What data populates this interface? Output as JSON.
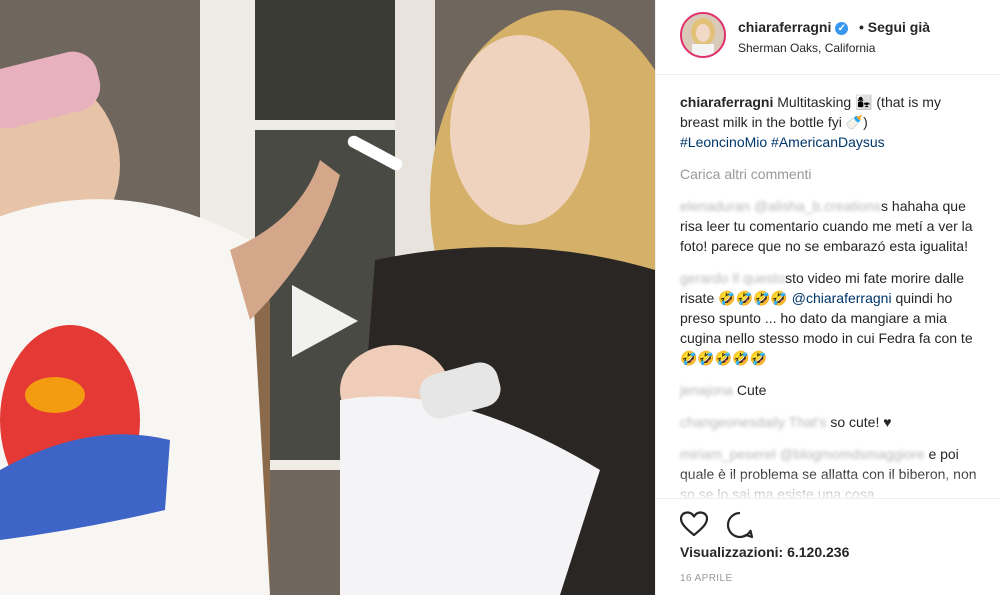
{
  "post": {
    "username": "chiaraferragni",
    "verified_icon": "verified-badge-icon",
    "follow_label": "• Segui già",
    "location": "Sherman Oaks, California"
  },
  "caption": {
    "user": "chiaraferragni",
    "text": "Multitasking 👩‍👧 (that is my breast milk in the bottle fyi 🍼)",
    "hashtags": "#LeoncinoMio #AmericanDaysus"
  },
  "load_more": "Carica altri commenti",
  "comments": [
    {
      "user": "elenaduran",
      "mention": "@alisha_b.creations",
      "text": "s hahaha que risa leer tu comentario cuando me metí a ver la foto! parece que no se embarazó esta igualita!"
    },
    {
      "user": "gerardo",
      "blurred_text": "Il questo",
      "text": "sto video mi fate morire dalle risate 🤣🤣🤣🤣",
      "mention": "@chiaraferragni",
      "text2": "quindi ho preso spunto ... ho dato da mangiare a mia cugina nello stesso modo in cui Fedra fa con te 🤣🤣🤣🤣🤣"
    },
    {
      "user": "jenajona",
      "text": "Cute"
    },
    {
      "user": "changeonesdaily",
      "blurred_text": "That's",
      "text": "so cute! ♥"
    },
    {
      "user": "miriam_peserel",
      "mention": "@blogmomdsmaggiore",
      "text": "e poi quale è il problema se allatta con il biberon, non so se lo sai ma esiste una cosa"
    }
  ],
  "actions": {
    "like_icon": "heart-icon",
    "comment_icon": "comment-icon"
  },
  "views_label": "Visualizzazioni: 6.120.236",
  "date": "16 APRILE"
}
